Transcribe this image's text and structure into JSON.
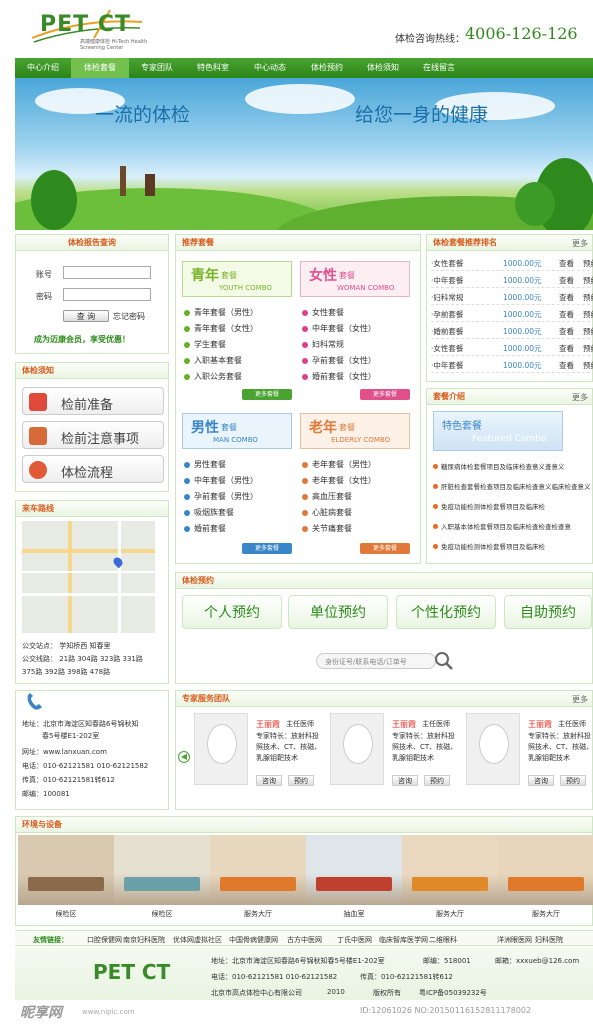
{
  "header": {
    "logo_text": "PET CT",
    "logo_sub": "高端健康体检 Hi-Tech Health Screening Center",
    "hotline_label": "体检咨询热线：",
    "hotline_number": "4006-126-126"
  },
  "nav": {
    "items": [
      "中心介绍",
      "体检套餐",
      "专家团队",
      "特色科室",
      "中心动态",
      "体检预约",
      "体检须知",
      "在线留言"
    ],
    "active_index": 1
  },
  "banner": {
    "slogan_left": "一流的体检",
    "slogan_right": "给您一身的健康"
  },
  "report": {
    "title": "体检报告查询",
    "account_label": "账号",
    "password_label": "密码",
    "query_button": "查 询",
    "forgot_link": "忘记密码",
    "promo": "成为迈康会员，享受优惠！"
  },
  "guide": {
    "title": "体检须知",
    "items": [
      {
        "label": "检前准备",
        "icon": "first-aid-kit-icon",
        "color": "#e04a3a"
      },
      {
        "label": "检前注意事项",
        "icon": "clipboard-icon",
        "color": "#d86a3a"
      },
      {
        "label": "体检流程",
        "icon": "medicine-bottle-icon",
        "color": "#e05a3a"
      }
    ]
  },
  "route": {
    "title": "来车路线",
    "bus_stop": "公交站点： 学知桥西 知春里",
    "bus_lines_1": "公交线路： 21路 304路 323路 331路",
    "bus_lines_2": "375路 392路 398路 478路"
  },
  "contact": {
    "address_1": "地址：北京市海淀区知春路6号锦秋知",
    "address_2": "春5号楼E1-202室",
    "website": "网址：www.lanxuan.com",
    "phone": "电话：010-62121581  010-62121582",
    "fax": "传真：010-62121581转612",
    "postcode": "邮编：100081"
  },
  "packages": {
    "title": "推荐套餐",
    "more_label": "更多套餐",
    "groups": [
      {
        "title": "青年",
        "suffix": "套餐",
        "en": "YOUTH COMBO",
        "color": "#7ab32a",
        "bg": "#f3fbe6"
      },
      {
        "title": "女性",
        "suffix": "套餐",
        "en": "WOMAN COMBO",
        "color": "#e0508a",
        "bg": "#fdeef4"
      },
      {
        "title": "男性",
        "suffix": "套餐",
        "en": "MAN COMBO",
        "color": "#3a86c8",
        "bg": "#eaf4fc"
      },
      {
        "title": "老年",
        "suffix": "套餐",
        "en": "ELDERLY COMBO",
        "color": "#e07a3a",
        "bg": "#fdf1e8"
      }
    ],
    "youth_items": [
      "青年套餐（男性）",
      "青年套餐（女性）",
      "学生套餐",
      "入职基本套餐",
      "入职公务套餐"
    ],
    "woman_items": [
      "女性套餐",
      "中年套餐（女性）",
      "妇科常规",
      "孕前套餐（女性）",
      "婚前套餐（女性）"
    ],
    "man_items": [
      "男性套餐",
      "中年套餐（男性）",
      "孕前套餐（男性）",
      "吸烟族套餐",
      "婚前套餐"
    ],
    "elderly_items": [
      "老年套餐（男性）",
      "老年套餐（女性）",
      "高血压套餐",
      "心脏病套餐",
      "关节痛套餐"
    ]
  },
  "ranking": {
    "title": "体检套餐推荐排名",
    "more": "更多",
    "rows": [
      {
        "name": "·女性套餐",
        "price": "1000.00元",
        "view": "查看",
        "book": "预约"
      },
      {
        "name": "·中年套餐",
        "price": "1000.00元",
        "view": "查看",
        "book": "预约"
      },
      {
        "name": "·妇科常规",
        "price": "1000.00元",
        "view": "查看",
        "book": "预约"
      },
      {
        "name": "·孕前套餐",
        "price": "1000.00元",
        "view": "查看",
        "book": "预约"
      },
      {
        "name": "·婚前套餐",
        "price": "1000.00元",
        "view": "查看",
        "book": "预约"
      },
      {
        "name": "·女性套餐",
        "price": "1000.00元",
        "view": "查看",
        "book": "预约"
      },
      {
        "name": "·中年套餐",
        "price": "1000.00元",
        "view": "查看",
        "book": "预约"
      }
    ]
  },
  "intro": {
    "title": "套餐介绍",
    "more": "更多",
    "featured_cn": "特色套餐",
    "featured_en": "Featured Combo",
    "items": [
      "糖尿病体检套餐项目及临床检查意义查意义",
      "肝脏检查套餐检查项目及临床检查意义临床检查意义",
      "免疫功能检测体检套餐项目及临床检",
      "入职基本体检套餐项目及临床检查检查检查意",
      "免疫功能检测体检套餐项目及临床检"
    ]
  },
  "booking": {
    "title": "体检预约",
    "buttons": [
      "个人预约",
      "单位预约",
      "个性化预约",
      "自助预约"
    ],
    "search_placeholder": "身份证号/联系电话/订单号"
  },
  "experts": {
    "title": "专家服务团队",
    "more": "更多",
    "items": [
      {
        "name": "王丽霞",
        "title": "主任医师",
        "spec": "专家特长：放射科投照技术、CT、核磁、乳腺钼靶技术",
        "consult": "咨询",
        "book": "预约"
      },
      {
        "name": "王丽霞",
        "title": "主任医师",
        "spec": "专家特长：放射科投照技术、CT、核磁、乳腺钼靶技术",
        "consult": "咨询",
        "book": "预约"
      },
      {
        "name": "王丽霞",
        "title": "主任医师",
        "spec": "专家特长：放射科投照技术、CT、核磁、乳腺钼靶技术",
        "consult": "咨询",
        "book": "预约"
      }
    ]
  },
  "environment": {
    "title": "环境与设备",
    "captions": [
      "候检区",
      "候检区",
      "服务大厅",
      "抽血室",
      "服务大厅",
      "服务大厅"
    ]
  },
  "links": {
    "title": "友情链接：",
    "items": [
      "口腔保健网",
      "南京妇科医院",
      "优体网虚拟社区",
      "中国骨病健康网",
      "古方中医网",
      "丁氏中医网",
      "临床智库医学网",
      "二维眼科",
      "洋洲眼医网",
      "妇科医院"
    ]
  },
  "footer": {
    "address": "地址：北京市海淀区知春路6号锦秋知春5号楼E1-202室",
    "postcode": "邮编：518001",
    "email": "邮箱：xxxueb@126.com",
    "phone": "电话：010-62121581  010-62121582",
    "fax": "传真：010-62121581转612",
    "company": "北京市高点体检中心有限公司",
    "year": "2010",
    "rights": "版权所有",
    "icp": "粤ICP备05039232号"
  },
  "watermark": {
    "logo": "昵享网",
    "url": "www.nipic.com",
    "id": "ID:12061026 NO:20150116152811178002"
  }
}
